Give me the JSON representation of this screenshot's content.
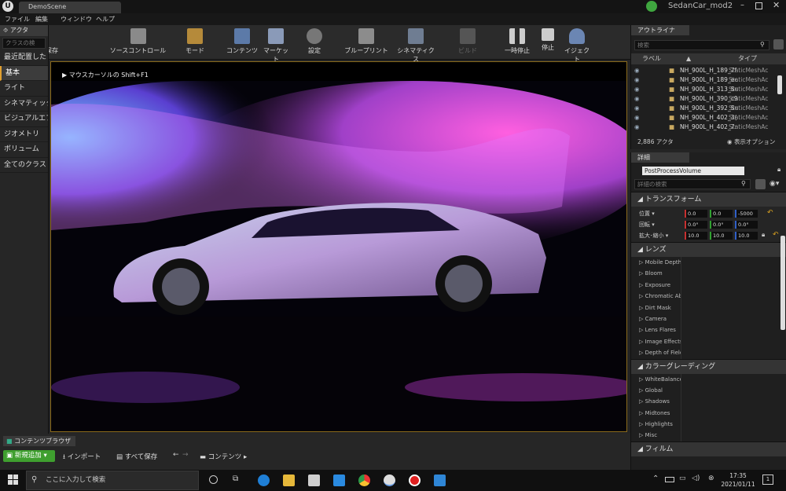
{
  "titlebar": {
    "tab": "DemoScene",
    "project": "SedanCar_mod2"
  },
  "menu": [
    "ファイル",
    "編集",
    "ウィンドウ",
    "ヘルプ"
  ],
  "toolbar": [
    {
      "label": "現在のレベルを保存",
      "icon": "save-icon"
    },
    {
      "label": "ソースコントロール",
      "icon": "source-control-icon"
    },
    {
      "label": "モード",
      "icon": "modes-icon"
    },
    {
      "label": "コンテンツ",
      "icon": "content-icon"
    },
    {
      "label": "マーケット",
      "icon": "marketplace-icon"
    },
    {
      "label": "設定",
      "icon": "settings-icon"
    },
    {
      "label": "ブループリント",
      "icon": "blueprint-icon"
    },
    {
      "label": "シネマティクス",
      "icon": "cinematics-icon"
    },
    {
      "label": "ビルド",
      "icon": "build-icon"
    },
    {
      "label": "一時停止",
      "icon": "pause-icon"
    },
    {
      "label": "停止",
      "icon": "stop-icon"
    },
    {
      "label": "イジェクト",
      "icon": "eject-icon"
    }
  ],
  "modes": {
    "tab": "アクタ",
    "search_placeholder": "クラスの検",
    "items": [
      "最近配置した",
      "基本",
      "ライト",
      "シネマティック",
      "ビジュアルエフ",
      "ジオメトリ",
      "ボリューム",
      "全てのクラス"
    ]
  },
  "viewport": {
    "hint": "マウスカーソルの Shift+F1"
  },
  "outliner": {
    "tab": "アウトライナ",
    "search_placeholder": "検索",
    "col_label": "ラベル",
    "col_type": "タイプ",
    "rows": [
      {
        "name": "NH_900L_H_189_7f",
        "type": "StaticMeshAc"
      },
      {
        "name": "NH_900L_H_189_ec",
        "type": "StaticMeshAc"
      },
      {
        "name": "NH_900L_H_313_Su",
        "type": "StaticMeshAc"
      },
      {
        "name": "NH_900L_H_390_c9",
        "type": "StaticMeshAc"
      },
      {
        "name": "NH_900L_H_392_Su",
        "type": "StaticMeshAc"
      },
      {
        "name": "NH_900L_H_402_3(",
        "type": "StaticMeshAc"
      },
      {
        "name": "NH_900L_H_402_7:",
        "type": "StaticMeshAc"
      }
    ],
    "count": "2,886 アクタ",
    "view_options": "表示オプション"
  },
  "details": {
    "tab": "詳細",
    "object": "PostProcessVolume",
    "search_placeholder": "詳細の検索",
    "transform": {
      "title": "トランスフォーム",
      "location_label": "位置",
      "rotation_label": "回転",
      "scale_label": "拡大･縮小",
      "location": [
        "0.0",
        "0.0",
        "-5000"
      ],
      "rotation": [
        "0.0°",
        "0.0°",
        "0.0°"
      ],
      "scale": [
        "10.0",
        "10.0",
        "10.0"
      ]
    },
    "lens": {
      "title": "レンズ",
      "items": [
        "Mobile Depth of F",
        "Bloom",
        "Exposure",
        "Chromatic Aberra",
        "Dirt Mask",
        "Camera",
        "Lens Flares",
        "Image Effects",
        "Depth of Field"
      ]
    },
    "grading": {
      "title": "カラーグレーディング",
      "items": [
        "WhiteBalance",
        "Global",
        "Shadows",
        "Midtones",
        "Highlights",
        "Misc"
      ]
    },
    "film": {
      "title": "フィルム"
    }
  },
  "content_browser": {
    "tab": "コンテンツブラウザ",
    "add_new": "新規追加",
    "import": "インポート",
    "save_all": "すべて保存",
    "path": "コンテンツ"
  },
  "taskbar": {
    "search_placeholder": "ここに入力して検索",
    "time": "17:35",
    "date": "2021/01/11",
    "notifications": "1"
  }
}
